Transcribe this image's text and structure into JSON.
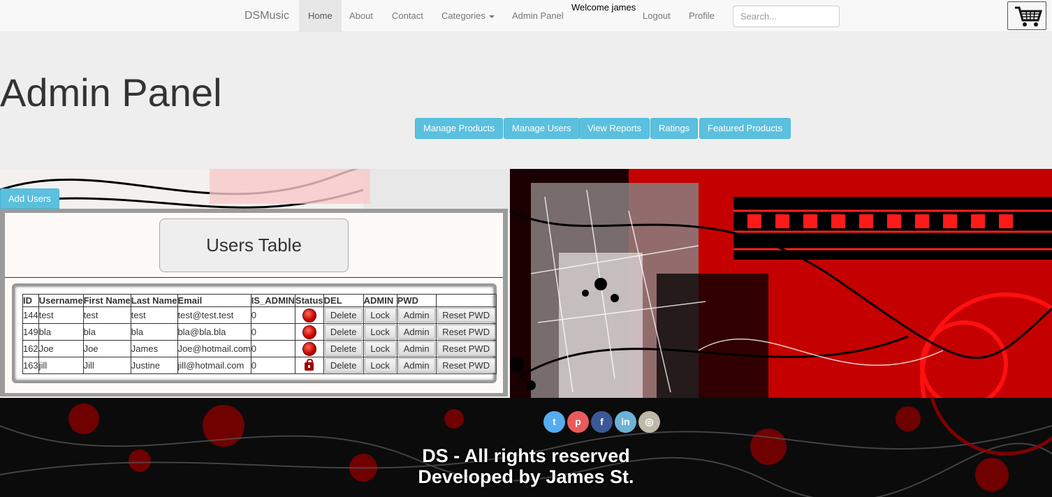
{
  "navbar": {
    "brand": "DSMusic",
    "items": [
      {
        "label": "Home"
      },
      {
        "label": "About"
      },
      {
        "label": "Contact"
      },
      {
        "label": "Categories"
      },
      {
        "label": "Admin Panel"
      },
      {
        "label": "Logout"
      },
      {
        "label": "Profile"
      }
    ],
    "welcome": "Welcome james",
    "search_placeholder": "Search...",
    "cart_icon": "shopping-cart-icon"
  },
  "jumbotron": {
    "title": "Admin Panel",
    "buttons": [
      {
        "label": "Manage Products"
      },
      {
        "label": "Manage Users"
      },
      {
        "label": "View Reports"
      },
      {
        "label": "Ratings"
      },
      {
        "label": "Featured Products"
      }
    ]
  },
  "add_users_label": "Add Users",
  "users_table": {
    "title": "Users Table",
    "headers": [
      "ID",
      "Username",
      "First Name",
      "Last Name",
      "Email",
      "IS_ADMIN",
      "Status",
      "DEL",
      "ADMIN",
      "PWD",
      ""
    ],
    "rows": [
      {
        "id": "144",
        "username": "test",
        "first": "test",
        "last": "test",
        "email": "test@test.test",
        "is_admin": "0",
        "status": "red-dot"
      },
      {
        "id": "149",
        "username": "bla",
        "first": "bla",
        "last": "bla",
        "email": "bla@bla.bla",
        "is_admin": "0",
        "status": "red-dot"
      },
      {
        "id": "162",
        "username": "Joe",
        "first": "Joe",
        "last": "James",
        "email": "Joe@hotmail.com",
        "is_admin": "0",
        "status": "red-dot"
      },
      {
        "id": "163",
        "username": "jill",
        "first": "Jill",
        "last": "Justine",
        "email": "jill@hotmail.com",
        "is_admin": "0",
        "status": "lock"
      }
    ],
    "row_buttons": {
      "delete": "Delete",
      "lock": "Lock",
      "admin": "Admin",
      "reset": "Reset PWD"
    }
  },
  "social": [
    {
      "icon": "twitter-icon",
      "glyph": "t",
      "color": "#55acee"
    },
    {
      "icon": "pinterest-icon",
      "glyph": "p",
      "color": "#e95b5b"
    },
    {
      "icon": "facebook-icon",
      "glyph": "f",
      "color": "#3b5998"
    },
    {
      "icon": "linkedin-icon",
      "glyph": "in",
      "color": "#6bb3d6"
    },
    {
      "icon": "instagram-icon",
      "glyph": "◎",
      "color": "#bdb8a8"
    }
  ],
  "footer": {
    "line1": "DS - All rights reserved",
    "line2": "Developed by James St."
  },
  "colors": {
    "info": "#5bc0de",
    "accent_red": "#e00000"
  }
}
